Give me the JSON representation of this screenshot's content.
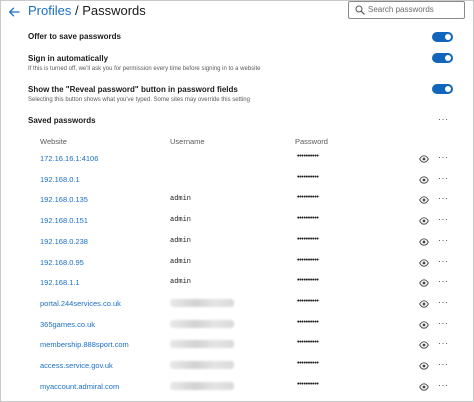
{
  "header": {
    "back_icon": "arrow-left-icon",
    "breadcrumb_link": "Profiles",
    "breadcrumb_separator": " / ",
    "breadcrumb_current": "Passwords",
    "search_placeholder": "Search passwords",
    "search_value": ""
  },
  "settings": {
    "offer": {
      "title": "Offer to save passwords",
      "on": true
    },
    "signin": {
      "title": "Sign in automatically",
      "desc": "If this is turned off, we'll ask you for permission every time before signing in to a website",
      "on": true
    },
    "reveal": {
      "title": "Show the \"Reveal password\" button in password fields",
      "desc": "Selecting this button shows what you've typed. Some sites may override this setting",
      "on": true
    }
  },
  "saved": {
    "title": "Saved passwords",
    "more_label": "···",
    "columns": {
      "website": "Website",
      "username": "Username",
      "password": "Password"
    },
    "rows": [
      {
        "site": "172.16.16.1:4106",
        "user": "",
        "password": "••••••••••"
      },
      {
        "site": "192.168.0.1",
        "user": "",
        "password": "••••••••••"
      },
      {
        "site": "192.168.0.135",
        "user": "admin",
        "password": "••••••••••"
      },
      {
        "site": "192.168.0.151",
        "user": "admin",
        "password": "••••••••••"
      },
      {
        "site": "192.168.0.238",
        "user": "admin",
        "password": "••••••••••"
      },
      {
        "site": "192.168.0.95",
        "user": "admin",
        "password": "••••••••••"
      },
      {
        "site": "192.168.1.1",
        "user": "admin",
        "password": "••••••••••"
      },
      {
        "site": "portal.244services.co.uk",
        "user": "[blurred]",
        "password": "••••••••••"
      },
      {
        "site": "365games.co.uk",
        "user": "[blurred]",
        "password": "••••••••••"
      },
      {
        "site": "membership.888sport.com",
        "user": "[blurred]",
        "password": "••••••••••"
      },
      {
        "site": "access.service.gov.uk",
        "user": "[blurred]",
        "password": "••••••••••"
      },
      {
        "site": "myaccount.admiral.com",
        "user": "[blurred]",
        "password": "••••••••••"
      }
    ]
  },
  "colors": {
    "accent": "#1a6fc4",
    "toggle_on": "#1166bb"
  }
}
